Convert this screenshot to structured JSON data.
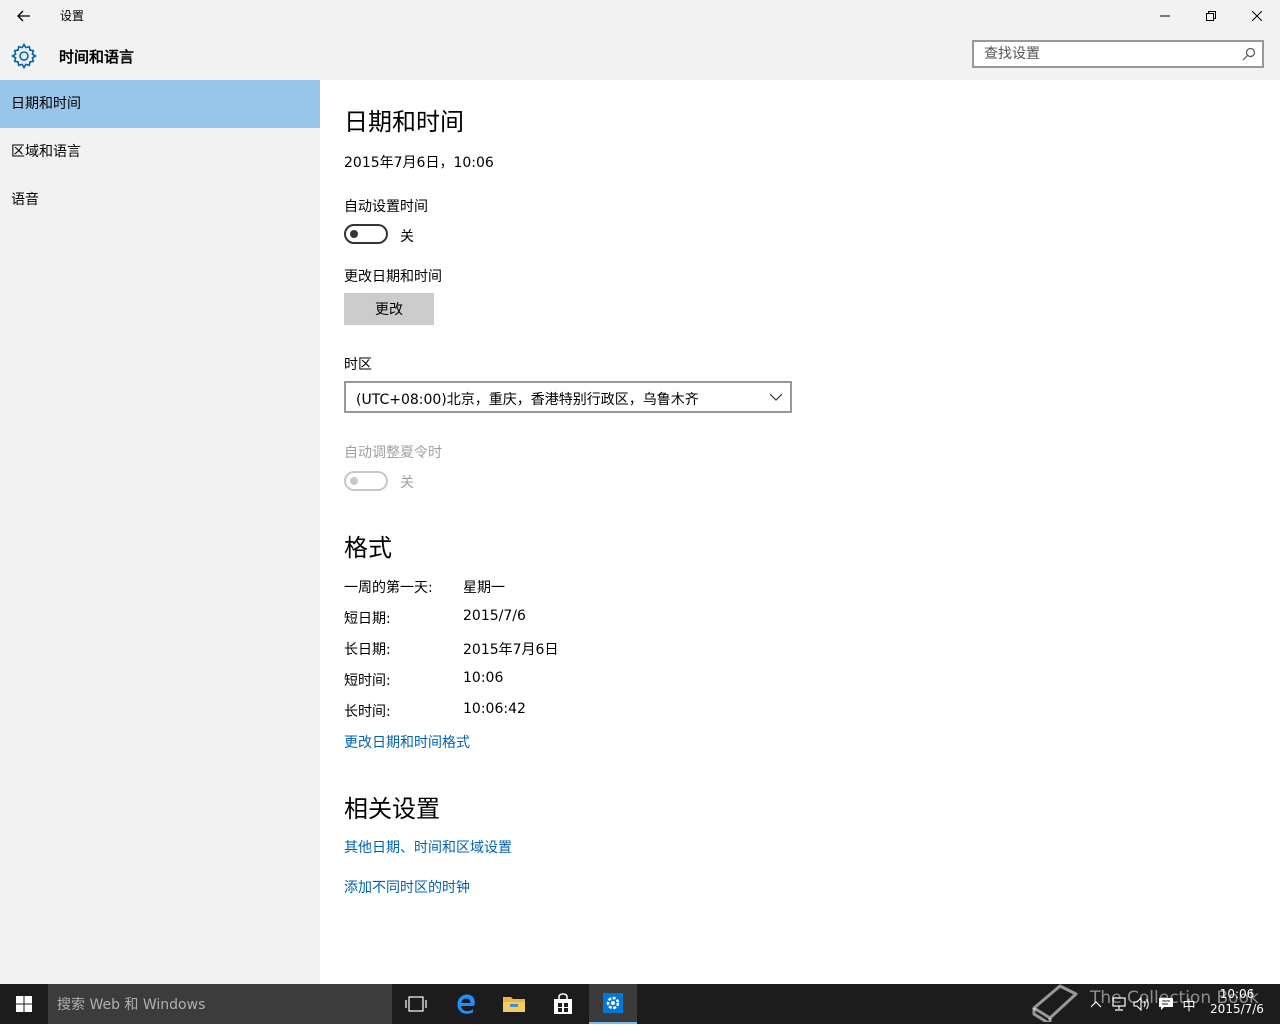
{
  "window": {
    "title": "设置"
  },
  "header": {
    "title": "时间和语言",
    "search_placeholder": "查找设置"
  },
  "sidebar": {
    "items": [
      {
        "label": "日期和时间",
        "active": true
      },
      {
        "label": "区域和语言",
        "active": false
      },
      {
        "label": "语音",
        "active": false
      }
    ]
  },
  "content": {
    "heading": "日期和时间",
    "current_datetime": "2015年7月6日，10:06",
    "auto_time": {
      "label": "自动设置时间",
      "state": "关"
    },
    "change_datetime": {
      "label": "更改日期和时间",
      "button": "更改"
    },
    "timezone": {
      "label": "时区",
      "value": "(UTC+08:00)北京，重庆，香港特别行政区，乌鲁木齐"
    },
    "dst": {
      "label": "自动调整夏令时",
      "state": "关"
    },
    "format": {
      "heading": "格式",
      "rows": [
        {
          "label": "一周的第一天:",
          "value": "星期一"
        },
        {
          "label": "短日期:",
          "value": "2015/7/6"
        },
        {
          "label": "长日期:",
          "value": "2015年7月6日"
        },
        {
          "label": "短时间:",
          "value": "10:06"
        },
        {
          "label": "长时间:",
          "value": "10:06:42"
        }
      ],
      "link": "更改日期和时间格式"
    },
    "related": {
      "heading": "相关设置",
      "links": [
        "其他日期、时间和区域设置",
        "添加不同时区的时钟"
      ]
    }
  },
  "taskbar": {
    "search_placeholder": "搜索 Web 和 Windows",
    "ime": "中",
    "clock_time": "10:06",
    "clock_date": "2015/7/6",
    "watermark": "The Collection Book"
  },
  "colors": {
    "accent": "#0063b1",
    "sidebar_active": "#99c5e8",
    "chrome": "#f2f2f2",
    "taskbar": "#1c1c1c"
  }
}
